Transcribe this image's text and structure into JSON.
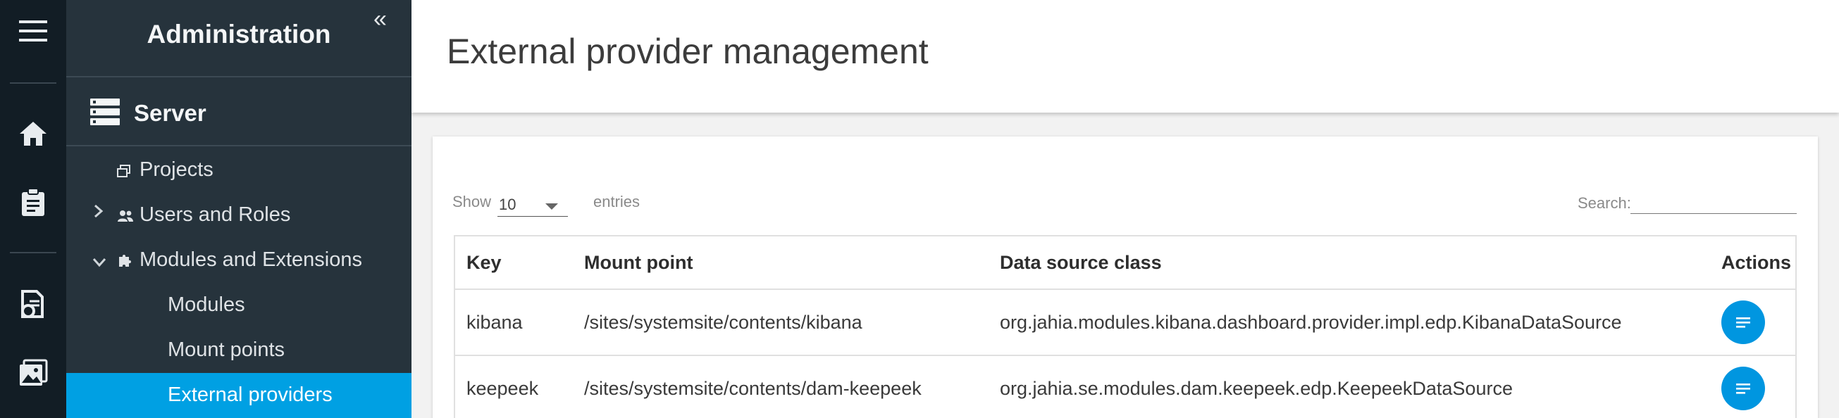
{
  "rail": {
    "icons": [
      "menu-icon",
      "home-icon",
      "clipboard-icon",
      "document-gear-icon",
      "image-icon"
    ]
  },
  "sidebar": {
    "title": "Administration",
    "collapse_label": "«",
    "section": {
      "label": "Server",
      "icon": "server-icon"
    },
    "items": [
      {
        "label": "Projects",
        "icon": "window-icon"
      },
      {
        "label": "Users and Roles",
        "icon": "users-icon",
        "chevron": "›"
      },
      {
        "label": "Modules and Extensions",
        "icon": "puzzle-icon",
        "chevron": "⌄"
      },
      {
        "label": "Modules"
      },
      {
        "label": "Mount points"
      },
      {
        "label": "External providers",
        "active": true
      }
    ]
  },
  "main": {
    "title": "External provider management",
    "show_label": "Show",
    "page_length": "10",
    "entries_label": "entries",
    "search_label": "Search:",
    "search_value": "",
    "table": {
      "columns": [
        "Key",
        "Mount point",
        "Data source class",
        "Actions"
      ],
      "rows": [
        {
          "key": "kibana",
          "mount_point": "/sites/systemsite/contents/kibana",
          "data_source_class": "org.jahia.modules.kibana.dashboard.provider.impl.edp.KibanaDataSource"
        },
        {
          "key": "keepeek",
          "mount_point": "/sites/systemsite/contents/dam-keepeek",
          "data_source_class": "org.jahia.se.modules.dam.keepeek.edp.KeepeekDataSource"
        }
      ]
    }
  },
  "colors": {
    "rail_bg": "#121d25",
    "sidebar_bg": "#26333c",
    "active_bg": "#00a0e3",
    "action_button": "#0096e0"
  }
}
